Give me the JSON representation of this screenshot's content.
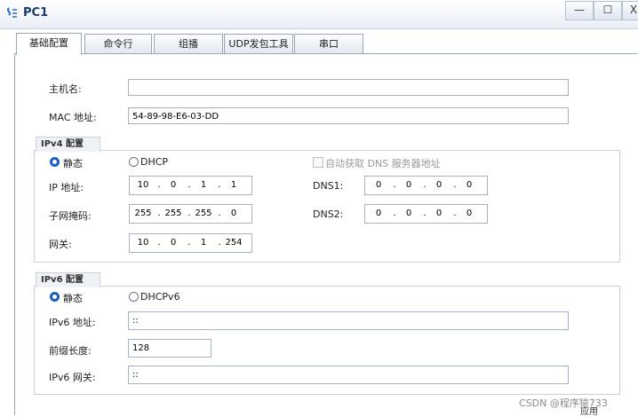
{
  "window": {
    "title": "PC1",
    "min": "—",
    "max": "☐",
    "close": "X"
  },
  "tabs": [
    "基础配置",
    "命令行",
    "组播",
    "UDP发包工具",
    "串口"
  ],
  "basic": {
    "hostname_label": "主机名:",
    "hostname_value": "",
    "mac_label": "MAC 地址:",
    "mac_value": "54-89-98-E6-03-DD"
  },
  "ipv4": {
    "group_label": "IPv4 配置",
    "static_label": "静态",
    "dhcp_label": "DHCP",
    "auto_dns_label": "自动获取 DNS 服务器地址",
    "ip_label": "IP 地址:",
    "ip": [
      "10",
      "0",
      "1",
      "1"
    ],
    "mask_label": "子网掩码:",
    "mask": [
      "255",
      "255",
      "255",
      "0"
    ],
    "gateway_label": "网关:",
    "gateway": [
      "10",
      "0",
      "1",
      "254"
    ],
    "dns1_label": "DNS1:",
    "dns1": [
      "0",
      "0",
      "0",
      "0"
    ],
    "dns2_label": "DNS2:",
    "dns2": [
      "0",
      "0",
      "0",
      "0"
    ]
  },
  "ipv6": {
    "group_label": "IPv6 配置",
    "static_label": "静态",
    "dhcp_label": "DHCPv6",
    "ip_label": "IPv6 地址:",
    "ip_value": "::",
    "prefix_label": "前缀长度:",
    "prefix_value": "128",
    "gateway_label": "IPv6 网关:",
    "gateway_value": "::"
  },
  "footer": {
    "apply": "应用",
    "watermark": "CSDN @程序猿733"
  },
  "colors": {
    "accent": "#1a5fc2",
    "title": "#1b3a6b"
  }
}
